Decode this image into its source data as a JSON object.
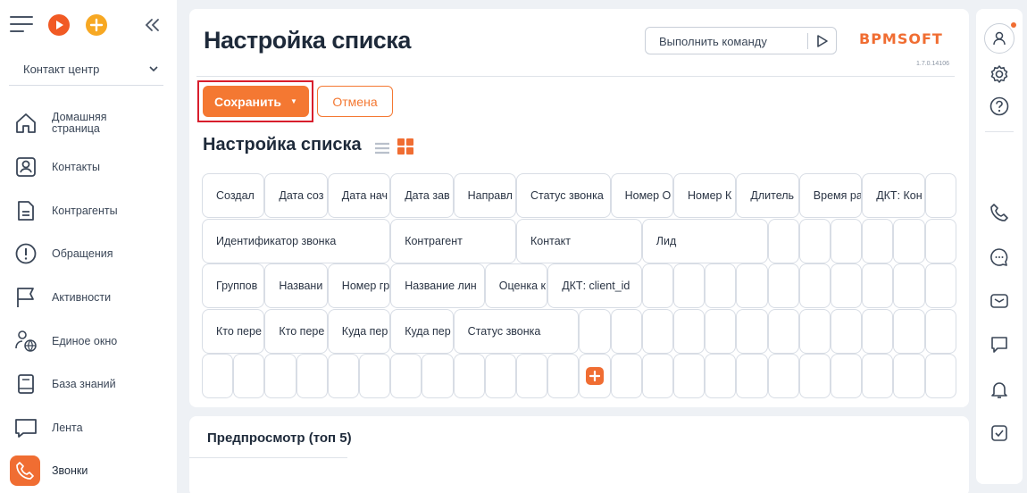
{
  "sidebar": {
    "workplace": "Контакт центр",
    "items": [
      {
        "label": "Домашняя страница",
        "icon": "home-icon"
      },
      {
        "label": "Контакты",
        "icon": "contact-card-icon"
      },
      {
        "label": "Контрагенты",
        "icon": "document-icon"
      },
      {
        "label": "Обращения",
        "icon": "alert-circle-icon"
      },
      {
        "label": "Активности",
        "icon": "flag-icon"
      },
      {
        "label": "Единое окно",
        "icon": "person-globe-icon"
      },
      {
        "label": "База знаний",
        "icon": "book-icon"
      },
      {
        "label": "Лента",
        "icon": "chat-bubble-icon"
      },
      {
        "label": "Звонки",
        "icon": "phone-icon"
      }
    ]
  },
  "header": {
    "title": "Настройка списка",
    "command_placeholder": "Выполнить команду",
    "logo": "BPMSOFT",
    "version": "1.7.0.14106"
  },
  "toolbar": {
    "save_label": "Сохранить",
    "cancel_label": "Отмена"
  },
  "section": {
    "title": "Настройка списка"
  },
  "grid": {
    "rows": [
      [
        "Создал",
        "Дата соз",
        "Дата нач",
        "Дата зав",
        "Направл",
        "Статус звонка",
        "Номер О",
        "Номер К",
        "Длитель",
        "Время ра",
        "ДКТ: Кон"
      ],
      [
        "Идентификатор звонка",
        "Контрагент",
        "Контакт",
        "Лид"
      ],
      [
        "Группов",
        "Названи",
        "Номер гр",
        "Название лин",
        "Оценка к",
        "ДКТ: client_id"
      ],
      [
        "Кто пере",
        "Кто пере",
        "Куда пер",
        "Куда пер",
        "Статус звонка"
      ]
    ]
  },
  "preview": {
    "title": "Предпросмотр (топ 5)"
  },
  "colors": {
    "accent": "#f47832",
    "highlight_border": "#d81e2c"
  }
}
